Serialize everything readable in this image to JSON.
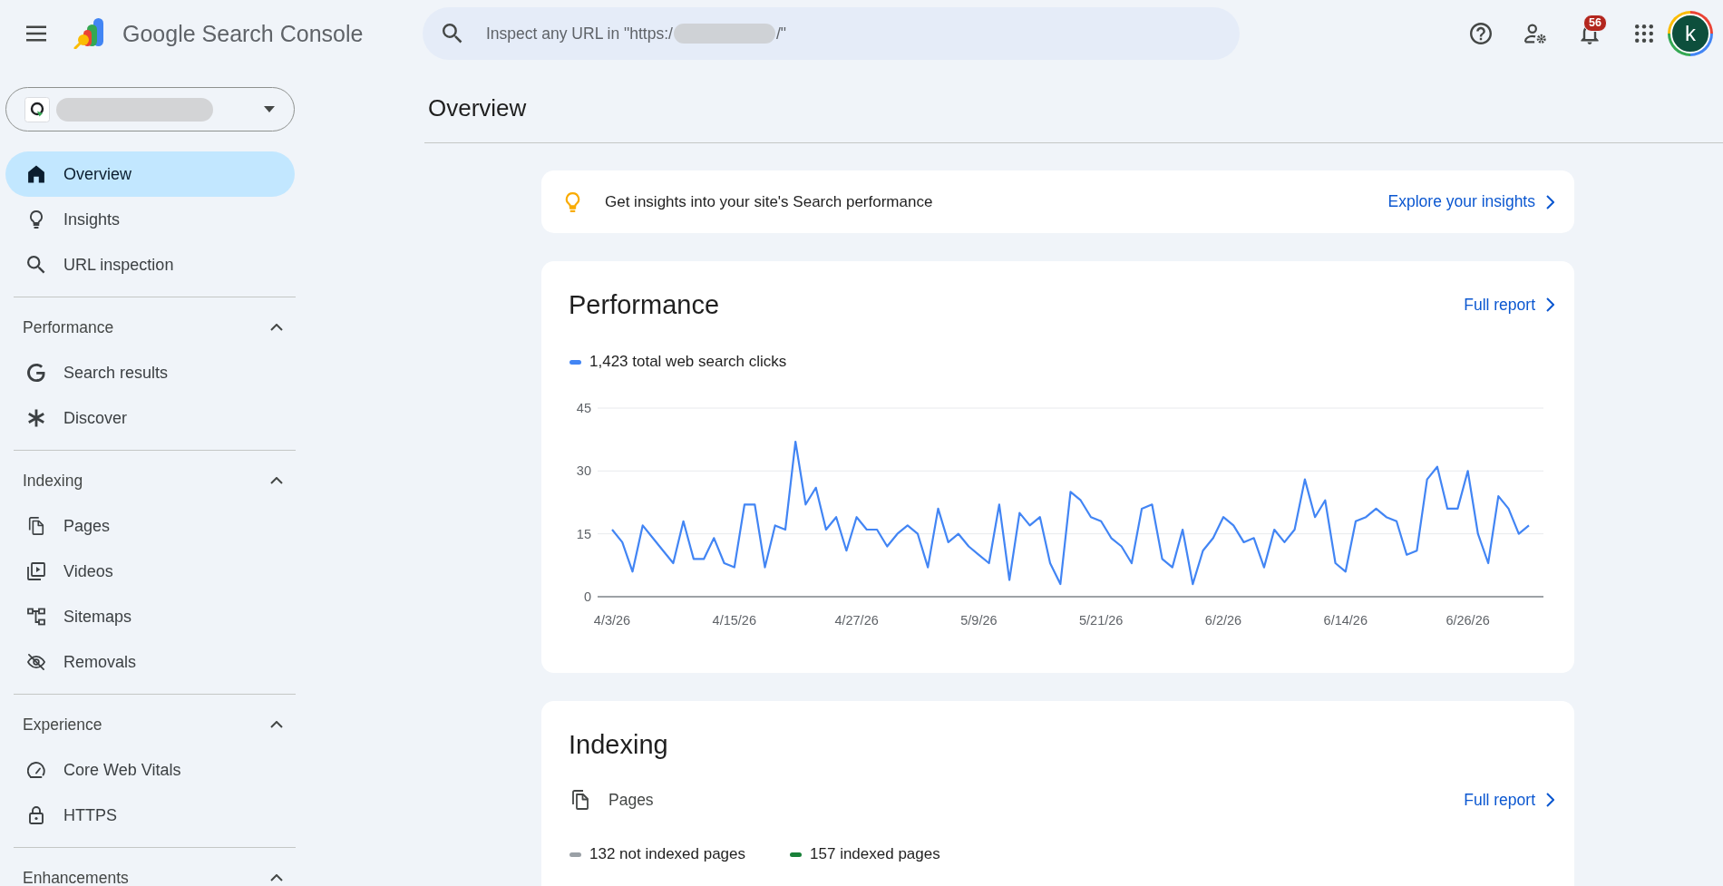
{
  "topbar": {
    "app_name": "Google Search Console",
    "search": {
      "placeholder": "Inspect any URL in \"https:/",
      "placeholder_tail": "/\""
    },
    "notification_count": "56",
    "avatar_letter": "k"
  },
  "sidebar": {
    "items": [
      {
        "label": "Overview",
        "selected": true
      },
      {
        "label": "Insights",
        "selected": false
      },
      {
        "label": "URL inspection",
        "selected": false
      }
    ],
    "sections": [
      {
        "title": "Performance",
        "expanded": true,
        "items": [
          {
            "label": "Search results",
            "selected": false
          },
          {
            "label": "Discover",
            "selected": false
          }
        ]
      },
      {
        "title": "Indexing",
        "expanded": true,
        "items": [
          {
            "label": "Pages",
            "selected": false
          },
          {
            "label": "Videos",
            "selected": false
          },
          {
            "label": "Sitemaps",
            "selected": false
          },
          {
            "label": "Removals",
            "selected": false
          }
        ]
      },
      {
        "title": "Experience",
        "expanded": true,
        "items": [
          {
            "label": "Core Web Vitals",
            "selected": false
          },
          {
            "label": "HTTPS",
            "selected": false
          }
        ]
      },
      {
        "title": "Enhancements",
        "expanded": true
      }
    ]
  },
  "main": {
    "page_title": "Overview",
    "insights_card": {
      "text": "Get insights into your site's Search performance",
      "link": "Explore your insights"
    },
    "performance_card": {
      "title": "Performance",
      "link": "Full report",
      "chart_data": {
        "type": "line",
        "categories": [
          "4/3/26",
          null,
          null,
          null,
          null,
          null,
          null,
          null,
          null,
          null,
          null,
          null,
          "4/15/26",
          null,
          null,
          null,
          null,
          null,
          null,
          null,
          null,
          null,
          null,
          null,
          "4/27/26",
          null,
          null,
          null,
          null,
          null,
          null,
          null,
          null,
          null,
          null,
          null,
          "5/9/26",
          null,
          null,
          null,
          null,
          null,
          null,
          null,
          null,
          null,
          null,
          null,
          "5/21/26",
          null,
          null,
          null,
          null,
          null,
          null,
          null,
          null,
          null,
          null,
          null,
          "6/2/26",
          null,
          null,
          null,
          null,
          null,
          null,
          null,
          null,
          null,
          null,
          null,
          "6/14/26",
          null,
          null,
          null,
          null,
          null,
          null,
          null,
          null,
          null,
          null,
          null,
          "6/26/26",
          null,
          null,
          null,
          null,
          null,
          null
        ],
        "ylim": [
          0,
          45
        ],
        "yticks": [
          0,
          15,
          30,
          45
        ],
        "series": [
          {
            "name": "1,423 total web search clicks",
            "color": "#4285f4",
            "values": [
              16,
              13,
              6,
              17,
              14,
              11,
              8,
              18,
              9,
              9,
              14,
              8,
              7,
              22,
              22,
              7,
              17,
              16,
              37,
              22,
              26,
              16,
              19,
              11,
              19,
              16,
              16,
              12,
              15,
              17,
              15,
              7,
              21,
              13,
              15,
              12,
              10,
              8,
              22,
              4,
              20,
              17,
              19,
              8,
              3,
              25,
              23,
              19,
              18,
              14,
              12,
              8,
              21,
              22,
              9,
              7,
              16,
              3,
              11,
              14,
              19,
              17,
              13,
              14,
              7,
              16,
              13,
              16,
              28,
              19,
              23,
              8,
              6,
              18,
              19,
              21,
              19,
              18,
              10,
              11,
              28,
              31,
              21,
              21,
              30,
              15,
              8,
              24,
              21,
              15,
              17
            ]
          }
        ]
      }
    },
    "indexing_card": {
      "title": "Indexing",
      "row_label": "Pages",
      "link": "Full report",
      "legend": [
        {
          "label": "132 not indexed pages",
          "color": "#9aa0a6"
        },
        {
          "label": "157 indexed pages",
          "color": "#188038"
        }
      ]
    }
  }
}
